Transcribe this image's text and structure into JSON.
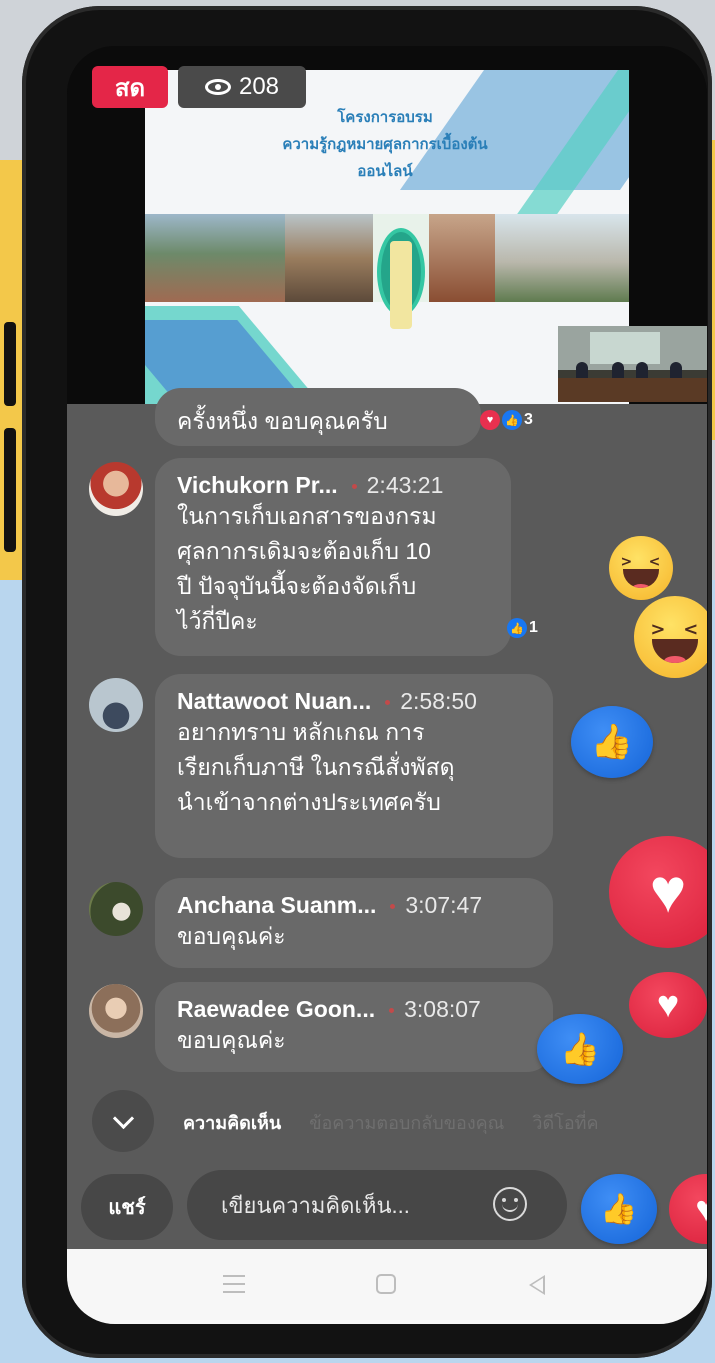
{
  "live": {
    "badge": "สด",
    "viewer_count": "208"
  },
  "video": {
    "slide_title_lines": [
      "โครงการอบรม",
      "ความรู้กฎหมายศุลกากรเบื้องต้น",
      "ออนไลน์"
    ]
  },
  "comments": [
    {
      "author": "",
      "time": "",
      "text": "ครั้งหนึ่ง ขอบคุณครับ",
      "reactions": {
        "icons": [
          "heart",
          "like"
        ],
        "count": "3"
      }
    },
    {
      "author": "Vichukorn Pr...",
      "time": "2:43:21",
      "text_lines": [
        "ในการเก็บเอกสารของกรม",
        "ศุลกากรเดิมจะต้องเก็บ 10",
        "ปี ปัจจุบันนี้จะต้องจัดเก็บ",
        "ไว้กี่ปีคะ"
      ],
      "reactions": {
        "icons": [
          "like"
        ],
        "count": "1"
      }
    },
    {
      "author": "Nattawoot Nuan...",
      "time": "2:58:50",
      "text_lines": [
        "อยากทราบ หลักเกณ การ",
        "เรียกเก็บภาษี ในกรณีสั่งพัสดุ",
        "นำเข้าจากต่างประเทศครับ"
      ]
    },
    {
      "author": "Anchana Suanm...",
      "time": "3:07:47",
      "text": "ขอบคุณค่ะ"
    },
    {
      "author": "Raewadee Goon...",
      "time": "3:08:07",
      "text": "ขอบคุณค่ะ"
    }
  ],
  "tabs": [
    "ความคิดเห็น",
    "ข้อความตอบกลับของคุณ",
    "วิดีโอที่ค"
  ],
  "actions": {
    "share_label": "แชร์",
    "comment_placeholder": "เขียนความคิดเห็น..."
  },
  "floating_reactions": [
    "haha",
    "haha",
    "like",
    "heart",
    "heart",
    "like",
    "like",
    "heart"
  ],
  "colors": {
    "live_red": "#e42648",
    "like_blue": "#1877f2",
    "heart_red": "#e8304f"
  }
}
